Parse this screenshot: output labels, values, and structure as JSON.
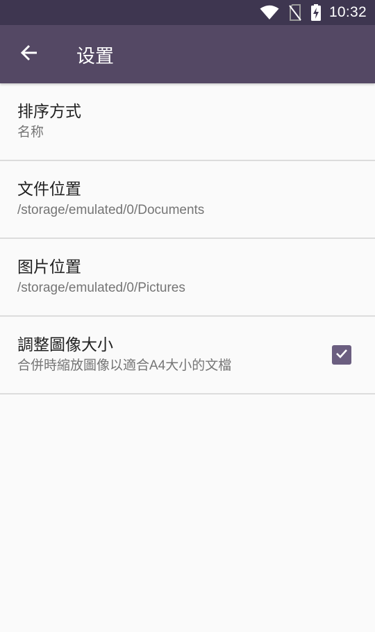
{
  "status_bar": {
    "time": "10:32",
    "icons": [
      "wifi-icon",
      "no-sim-icon",
      "battery-charging-icon"
    ]
  },
  "app_bar": {
    "back_icon": "arrow-left-icon",
    "title": "设置"
  },
  "preferences": [
    {
      "title": "排序方式",
      "summary": "名称"
    },
    {
      "title": "文件位置",
      "summary": "/storage/emulated/0/Documents"
    },
    {
      "title": "图片位置",
      "summary": "/storage/emulated/0/Pictures"
    },
    {
      "title": "調整圖像大小",
      "summary": "合併時縮放圖像以適合A4大小的文檔",
      "checked": true
    }
  ],
  "colors": {
    "status_bar": "#3e3650",
    "app_bar": "#544864",
    "accent": "#6b5e80",
    "background": "#fafafa"
  }
}
